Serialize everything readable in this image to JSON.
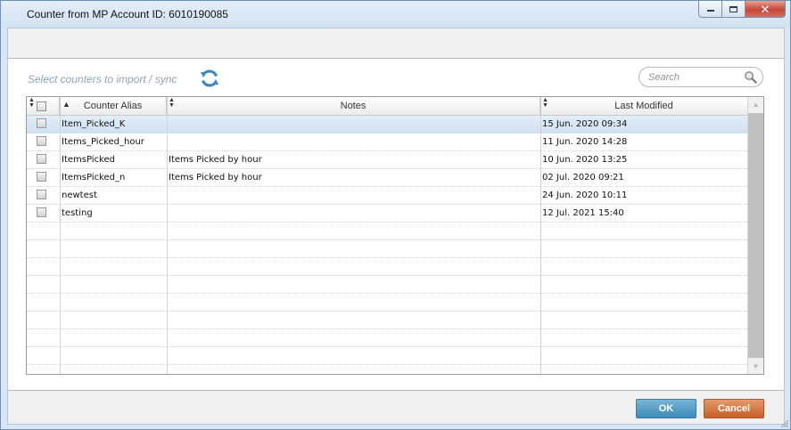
{
  "window": {
    "title": "Counter from MP Account ID: 6010190085"
  },
  "toolbar": {
    "select_label": "Select counters to import / sync",
    "sync_icon": "refresh-icon",
    "search_placeholder": "Search",
    "search_icon": "magnifier-icon"
  },
  "grid": {
    "columns": {
      "alias": "Counter Alias",
      "notes": "Notes",
      "modified": "Last Modified"
    },
    "rows": [
      {
        "alias": "Item_Picked_K",
        "notes": "",
        "modified": "15 Jun. 2020 09:34"
      },
      {
        "alias": "Items_Picked_hour",
        "notes": "",
        "modified": "11 Jun. 2020 14:28"
      },
      {
        "alias": "ItemsPicked",
        "notes": "Items Picked by hour",
        "modified": "10 Jun. 2020 13:25"
      },
      {
        "alias": "ItemsPicked_n",
        "notes": "Items Picked by hour",
        "modified": "02 Jul. 2020 09:21"
      },
      {
        "alias": "newtest",
        "notes": "",
        "modified": "24 Jun. 2020 10:11"
      },
      {
        "alias": "testing",
        "notes": "",
        "modified": "12 Jul. 2021 15:40"
      }
    ],
    "selected_row": 0
  },
  "footer": {
    "ok_label": "OK",
    "cancel_label": "Cancel"
  },
  "colors": {
    "accent_ok": "#3d8ab9",
    "accent_cancel": "#c55e2a",
    "selection": "#cfe0f1"
  }
}
